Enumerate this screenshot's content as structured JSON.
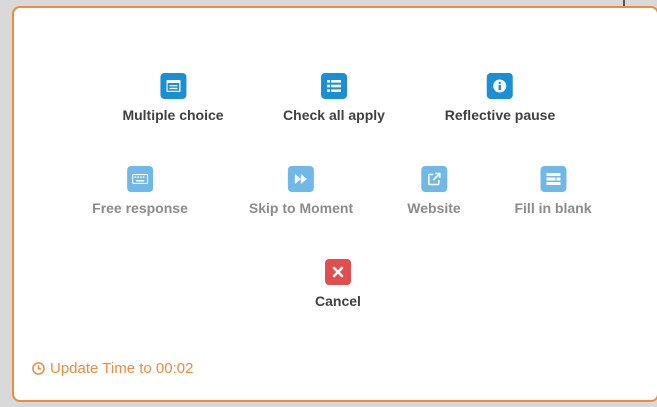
{
  "options_row1": [
    {
      "label": "Multiple choice",
      "icon": "window-list-icon"
    },
    {
      "label": "Check all apply",
      "icon": "list-icon"
    },
    {
      "label": "Reflective pause",
      "icon": "info-icon"
    }
  ],
  "options_row2": [
    {
      "label": "Free response",
      "icon": "keyboard-icon"
    },
    {
      "label": "Skip to Moment",
      "icon": "fast-forward-icon"
    },
    {
      "label": "Website",
      "icon": "external-link-icon"
    },
    {
      "label": "Fill in blank",
      "icon": "fill-blank-icon"
    }
  ],
  "cancel": {
    "label": "Cancel",
    "icon": "close-icon"
  },
  "update_time": {
    "label": "Update Time to 00:02",
    "icon": "clock-icon"
  },
  "colors": {
    "accent_orange": "#f08a3c",
    "icon_blue": "#1b8fd6",
    "icon_light_blue": "#6fb8e8",
    "cancel_red": "#e24d4d"
  }
}
